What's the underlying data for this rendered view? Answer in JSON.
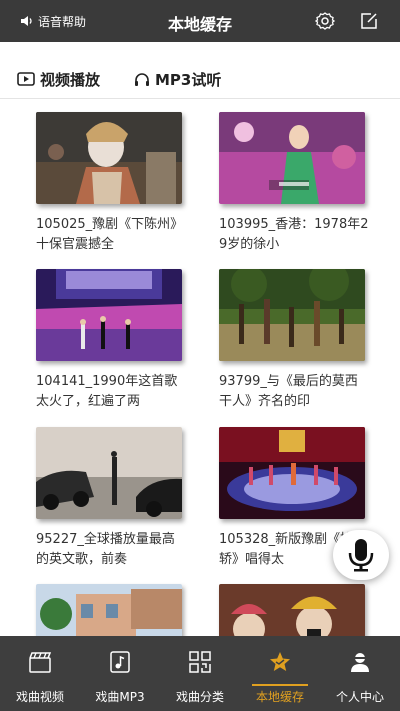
{
  "header": {
    "voice_help": "语音帮助",
    "title": "本地缓存",
    "settings_icon": "gear-icon",
    "edit_icon": "edit-icon"
  },
  "subtabs": {
    "video": "视频播放",
    "mp3": "MP3试听"
  },
  "videos": [
    {
      "caption": "105025_豫剧《下陈州》十保官震撼全"
    },
    {
      "caption": "103995_香港：1978年29岁的徐小"
    },
    {
      "caption": "104141_1990年这首歌太火了，红遍了两"
    },
    {
      "caption": "93799_与《最后的莫西干人》齐名的印"
    },
    {
      "caption": "95227_全球播放量最高的英文歌，前奏"
    },
    {
      "caption": "105328_新版豫剧《抬花轿》唱得太"
    },
    {
      "caption": ""
    },
    {
      "caption": ""
    }
  ],
  "nav": {
    "items": [
      {
        "label": "戏曲视频",
        "icon": "clapperboard-icon"
      },
      {
        "label": "戏曲MP3",
        "icon": "music-note-icon"
      },
      {
        "label": "戏曲分类",
        "icon": "qr-grid-icon"
      },
      {
        "label": "本地缓存",
        "icon": "star-icon"
      },
      {
        "label": "个人中心",
        "icon": "user-icon"
      }
    ],
    "active_color": "#e0a020"
  },
  "colors": {
    "header_bg": "#3a3a3a",
    "nav_bg": "#3e3e3e"
  }
}
